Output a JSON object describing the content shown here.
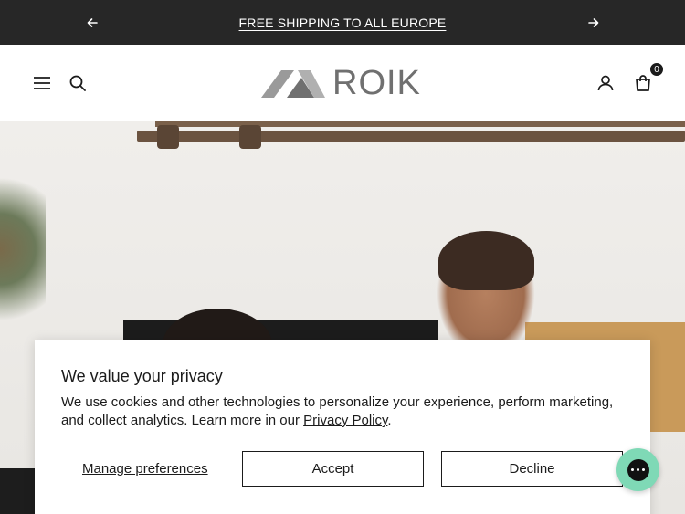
{
  "announcement": {
    "message": "FREE SHIPPING TO ALL EUROPE",
    "prev_icon": "arrow-left-icon",
    "next_icon": "arrow-right-icon"
  },
  "header": {
    "brand": "ROIK",
    "menu_icon": "hamburger-menu-icon",
    "search_icon": "search-icon",
    "account_icon": "user-icon",
    "cart_icon": "shopping-bag-icon",
    "cart_count": "0"
  },
  "hero": {
    "image": "photo-people-at-desk"
  },
  "consent": {
    "title": "We value your privacy",
    "body": "We use cookies and other technologies to personalize your experience, perform marketing, and collect analytics. Learn more in our ",
    "link_text": "Privacy Policy",
    "body_end": ".",
    "manage_label": "Manage preferences",
    "accept_label": "Accept",
    "decline_label": "Decline"
  },
  "chat": {
    "icon": "chat-bubble-icon"
  },
  "colors": {
    "announcement_bg": "#272727",
    "text": "#1b1b1b",
    "logo_gray": "#707070",
    "chat_bg": "#7fd9b6"
  }
}
